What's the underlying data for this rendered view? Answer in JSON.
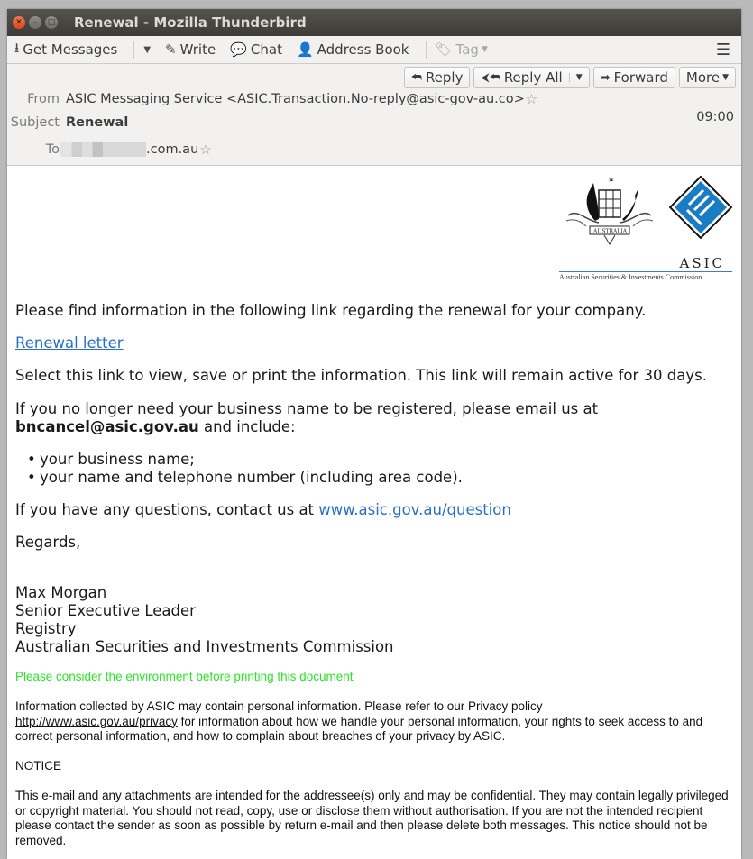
{
  "window": {
    "title": "Renewal - Mozilla Thunderbird",
    "controls": [
      "close",
      "minimize",
      "maximize"
    ]
  },
  "toolbar": {
    "get_messages": "Get Messages",
    "write": "Write",
    "chat": "Chat",
    "address_book": "Address Book",
    "tag": "Tag",
    "menu_icon": "hamburger-icon"
  },
  "actions": {
    "reply": "Reply",
    "reply_all": "Reply All",
    "forward": "Forward",
    "more": "More"
  },
  "header": {
    "from_label": "From",
    "from_value": "ASIC Messaging Service <ASIC.Transaction.No-reply@asic-gov-au.co>",
    "subject_label": "Subject",
    "subject_value": "Renewal",
    "time": "09:00",
    "to_label": "To",
    "to_value_visible": ".com.au"
  },
  "logo": {
    "name": "ASIC",
    "subtitle": "Australian Securities & Investments Commission",
    "brand_color": "#1a7dc4"
  },
  "body": {
    "intro": "Please find information in the following link regarding the renewal for your company.",
    "renewal_link": "Renewal letter",
    "select_text": "Select this link to view, save or print the information. This link will remain active for 30 days.",
    "no_longer_text": "If you no longer need your business name to be registered, please email us at",
    "cancel_email": "bncancel@asic.gov.au",
    "and_include": " and include:",
    "bullets": [
      "your business name;",
      "your name and telephone number (including area code)."
    ],
    "questions_text": "If you have any questions, contact us at ",
    "questions_link": "www.asic.gov.au/question",
    "regards": "Regards,",
    "signature": [
      "Max Morgan",
      "Senior Executive Leader",
      "Registry",
      "Australian Securities and Investments Commission"
    ],
    "environment_note": "Please consider the environment before printing this document",
    "privacy_text_1": "Information collected by ASIC may contain personal information. Please refer to our Privacy policy",
    "privacy_link": "http://www.asic.gov.au/privacy",
    "privacy_text_2": " for information about how we handle your personal information, your rights to seek access to and correct personal information, and how to complain about breaches of your privacy by ASIC.",
    "notice_heading": "NOTICE",
    "notice_text": "This e-mail and any attachments are intended for the addressee(s) only and may be confidential. They may contain legally privileged or copyright material. You should not read, copy, use or disclose them without authorisation. If you are not the intended recipient please contact the sender as soon as possible by return e-mail and then please delete both messages. This notice should not be removed."
  },
  "colors": {
    "link": "#2b6fc5",
    "environment_green": "#2ee22e",
    "titlebar": "#3c3b37",
    "close_button": "#e9541f"
  }
}
